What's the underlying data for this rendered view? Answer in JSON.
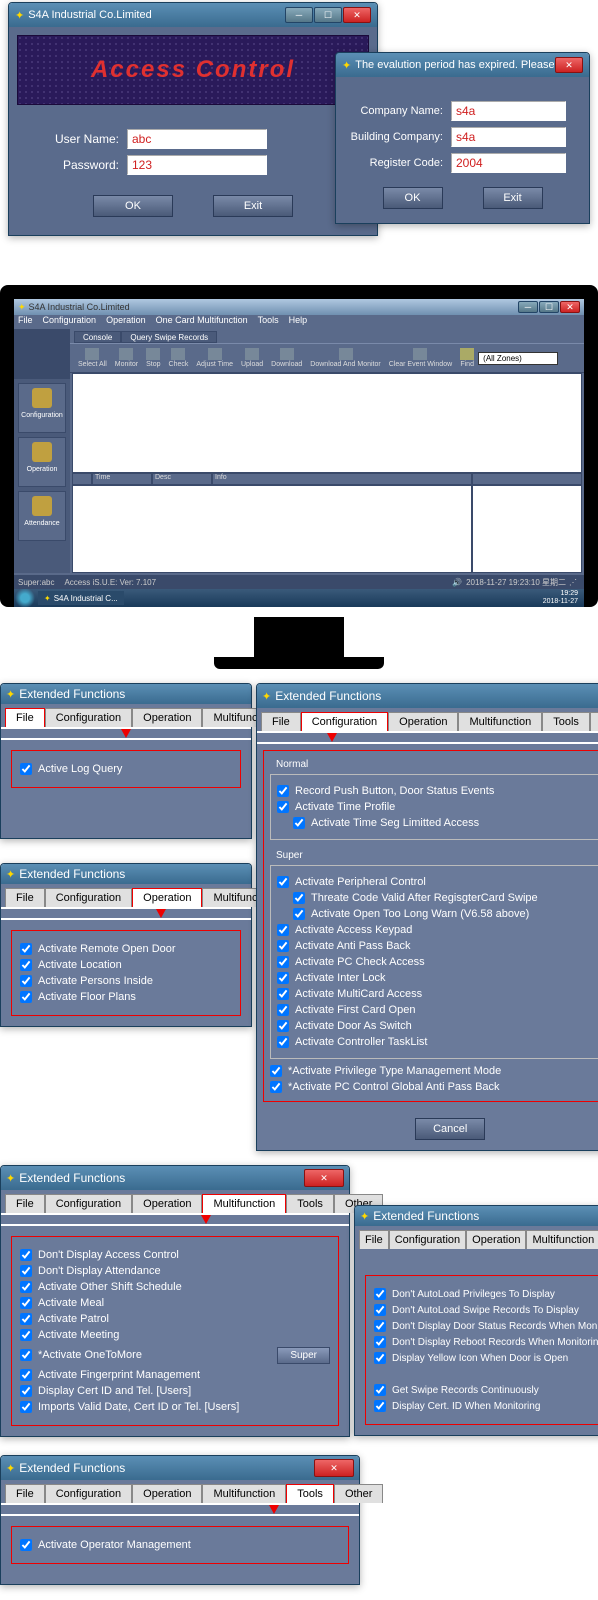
{
  "login": {
    "title": "S4A Industrial Co.Limited",
    "banner": "Access Control",
    "user_label": "User Name:",
    "user_value": "abc",
    "pass_label": "Password:",
    "pass_value": "123",
    "ok": "OK",
    "exit": "Exit"
  },
  "reg": {
    "title": "The evalution period has expired.  Please...",
    "company_label": "Company Name:",
    "company_value": "s4a",
    "building_label": "Building Company:",
    "building_value": "s4a",
    "code_label": "Register Code:",
    "code_value": "2004",
    "ok": "OK",
    "exit": "Exit"
  },
  "app": {
    "title": "S4A Industrial Co.Limited",
    "menu": [
      "File",
      "Configuration",
      "Operation",
      "One Card Multifunction",
      "Tools",
      "Help"
    ],
    "tabs": [
      "Console",
      "Query Swipe Records"
    ],
    "toolbar": [
      "Select All",
      "Monitor",
      "Stop",
      "Check",
      "Adjust Time",
      "Upload",
      "Download",
      "Download And Monitor",
      "Clear Event Window",
      "Find"
    ],
    "zone": "(All Zones)",
    "side": [
      "Configuration",
      "Operation",
      "Attendance"
    ],
    "cols": [
      "",
      "Time",
      "Desc",
      "Info"
    ],
    "status_user": "Super:abc",
    "status_ver": "Access  iS.U.E: Ver: 7.107",
    "status_time": "2018-11-27 19:23:10 星期二",
    "task": "S4A Industrial C...",
    "clock": "19:29",
    "date": "2018-11-27"
  },
  "ext": {
    "title": "Extended Functions",
    "tabs": {
      "file": "File",
      "config": "Configuration",
      "oper": "Operation",
      "multi": "Multifunction",
      "tools": "Tools",
      "other": "Other",
      "multitrunc": "Multifunct"
    },
    "file": {
      "item1": "Active Log Query"
    },
    "oper": {
      "i1": "Activate Remote Open Door",
      "i2": "Activate Location",
      "i3": "Activate Persons Inside",
      "i4": "Activate Floor Plans"
    },
    "config": {
      "normal": "Normal",
      "n1": "Record Push Button, Door Status Events",
      "n2": "Activate Time Profile",
      "n3": "Activate Time Seg Limitted Access",
      "super": "Super",
      "s1": "Activate Peripheral Control",
      "s2": "Threate Code Valid After RegisgterCard Swipe",
      "s3": "Activate Open Too Long Warn (V6.58 above)",
      "s4": "Activate Access Keypad",
      "s5": "Activate Anti Pass Back",
      "s6": "Activate PC Check Access",
      "s7": "Activate Inter Lock",
      "s8": "Activate MultiCard Access",
      "s9": "Activate First Card Open",
      "s10": "Activate Door As Switch",
      "s11": "Activate Controller TaskList",
      "s12": "*Activate Privilege Type Management Mode",
      "s13": "*Activate PC Control Global Anti Pass Back",
      "cancel": "Cancel"
    },
    "multi": {
      "i1": "Don't Display Access Control",
      "i2": "Don't Display Attendance",
      "i3": "Activate Other Shift Schedule",
      "i4": "Activate Meal",
      "i5": "Activate Patrol",
      "i6": "Activate Meeting",
      "i7": "*Activate OneToMore",
      "i8": "Activate Fingerprint Management",
      "i9": "Display Cert ID and Tel. [Users]",
      "i10": "Imports Valid Date,  Cert ID or Tel. [Users]",
      "super": "Super"
    },
    "other": {
      "i1": "Don't AutoLoad Privileges To Display",
      "i2": "Don't AutoLoad Swipe Records To Display",
      "i3": "Don't Display Door Status Records When Monitoring",
      "i4": "Don't Display Reboot Records When Monitoring",
      "i5": "Display Yellow Icon When Door is Open",
      "i6": "Get Swipe Records Continuously",
      "i7": "Display Cert. ID When Monitoring"
    },
    "tools": {
      "i1": "Activate Operator Management"
    }
  }
}
